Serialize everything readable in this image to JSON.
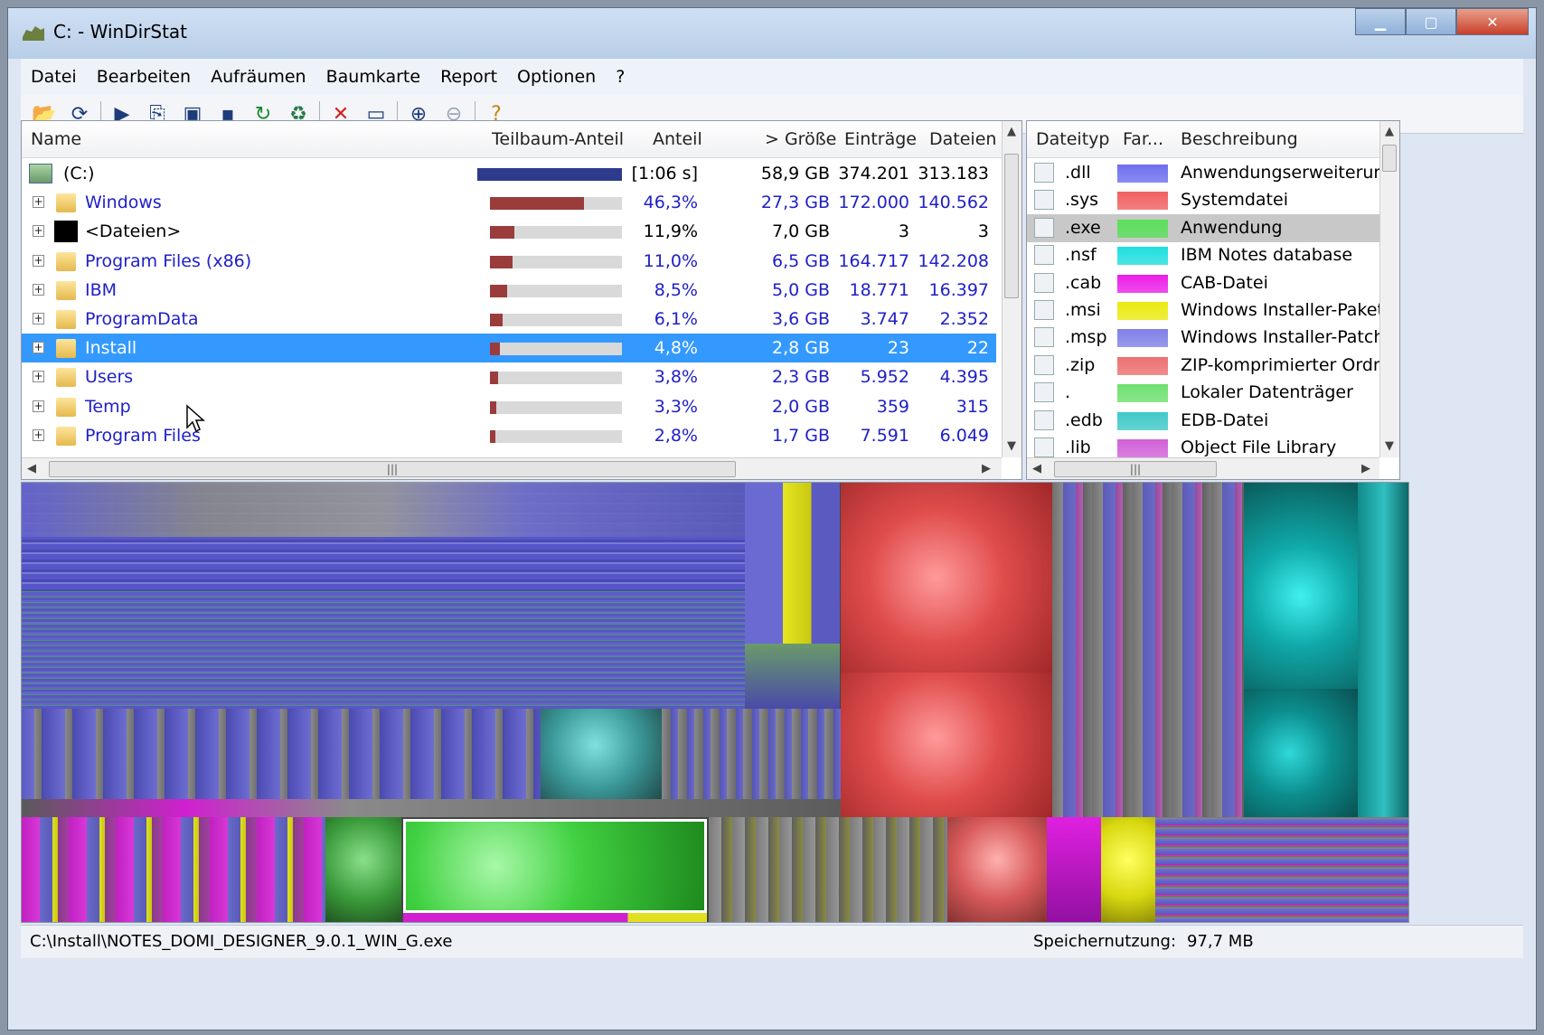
{
  "window": {
    "title": "C: - WinDirStat"
  },
  "menu": [
    "Datei",
    "Bearbeiten",
    "Aufräumen",
    "Baumkarte",
    "Report",
    "Optionen",
    "?"
  ],
  "toolbar": {
    "buttons": [
      "open-icon",
      "refresh-icon",
      "play-icon",
      "copy-icon",
      "explorer-icon",
      "cmd-icon",
      "refresh-all-icon",
      "recycle-icon",
      "delete-icon",
      "properties-icon",
      "zoom-in-icon",
      "zoom-out-icon",
      "help-icon"
    ]
  },
  "tree": {
    "columns": {
      "name": "Name",
      "subtree": "Teilbaum-Anteil",
      "share": "Anteil",
      "size": "> Größe",
      "entries": "Einträge",
      "files": "Dateien"
    },
    "rows": [
      {
        "name": "(C:)",
        "share": "[1:06 s]",
        "size": "58,9 GB",
        "entries": "374.201",
        "files": "313.183",
        "bar": 1.0,
        "root": true,
        "color": "#000000"
      },
      {
        "name": "Windows",
        "share": "46,3%",
        "size": "27,3 GB",
        "entries": "172.000",
        "files": "140.562",
        "bar": 0.463
      },
      {
        "name": "<Dateien>",
        "share": "11,9%",
        "size": "7,0 GB",
        "entries": "3",
        "files": "3",
        "bar": 0.119,
        "black": true
      },
      {
        "name": "Program Files (x86)",
        "share": "11,0%",
        "size": "6,5 GB",
        "entries": "164.717",
        "files": "142.208",
        "bar": 0.11
      },
      {
        "name": "IBM",
        "share": "8,5%",
        "size": "5,0 GB",
        "entries": "18.771",
        "files": "16.397",
        "bar": 0.085
      },
      {
        "name": "ProgramData",
        "share": "6,1%",
        "size": "3,6 GB",
        "entries": "3.747",
        "files": "2.352",
        "bar": 0.061
      },
      {
        "name": "Install",
        "share": "4,8%",
        "size": "2,8 GB",
        "entries": "23",
        "files": "22",
        "bar": 0.048,
        "selected": true
      },
      {
        "name": "Users",
        "share": "3,8%",
        "size": "2,3 GB",
        "entries": "5.952",
        "files": "4.395",
        "bar": 0.038
      },
      {
        "name": "Temp",
        "share": "3,3%",
        "size": "2,0 GB",
        "entries": "359",
        "files": "315",
        "bar": 0.033
      },
      {
        "name": "Program Files",
        "share": "2,8%",
        "size": "1,7 GB",
        "entries": "7.591",
        "files": "6.049",
        "bar": 0.028
      }
    ]
  },
  "ext": {
    "columns": {
      "type": "Dateityp",
      "color": "Far...",
      "desc": "Beschreibung"
    },
    "rows": [
      {
        "ext": ".dll",
        "color": "#6e6ef0",
        "desc": "Anwendungserweiterung"
      },
      {
        "ext": ".sys",
        "color": "#f06060",
        "desc": "Systemdatei"
      },
      {
        "ext": ".exe",
        "color": "#5ce05c",
        "desc": "Anwendung",
        "highlight": true
      },
      {
        "ext": ".nsf",
        "color": "#20dede",
        "desc": "IBM Notes database"
      },
      {
        "ext": ".cab",
        "color": "#ec1ee8",
        "desc": "CAB-Datei"
      },
      {
        "ext": ".msi",
        "color": "#eaea10",
        "desc": "Windows Installer-Paket"
      },
      {
        "ext": ".msp",
        "color": "#8080e8",
        "desc": "Windows Installer-Patch"
      },
      {
        "ext": ".zip",
        "color": "#ec7070",
        "desc": "ZIP-komprimierter Ordne"
      },
      {
        "ext": ".",
        "color": "#6ee06e",
        "desc": "Lokaler Datenträger"
      },
      {
        "ext": ".edb",
        "color": "#40c8c8",
        "desc": "EDB-Datei"
      },
      {
        "ext": ".lib",
        "color": "#d060d8",
        "desc": "Object File Library"
      }
    ]
  },
  "status": {
    "path": "C:\\Install\\NOTES_DOMI_DESIGNER_9.0.1_WIN_G.exe",
    "memory_label": "Speichernutzung:",
    "memory_value": "97,7 MB"
  }
}
